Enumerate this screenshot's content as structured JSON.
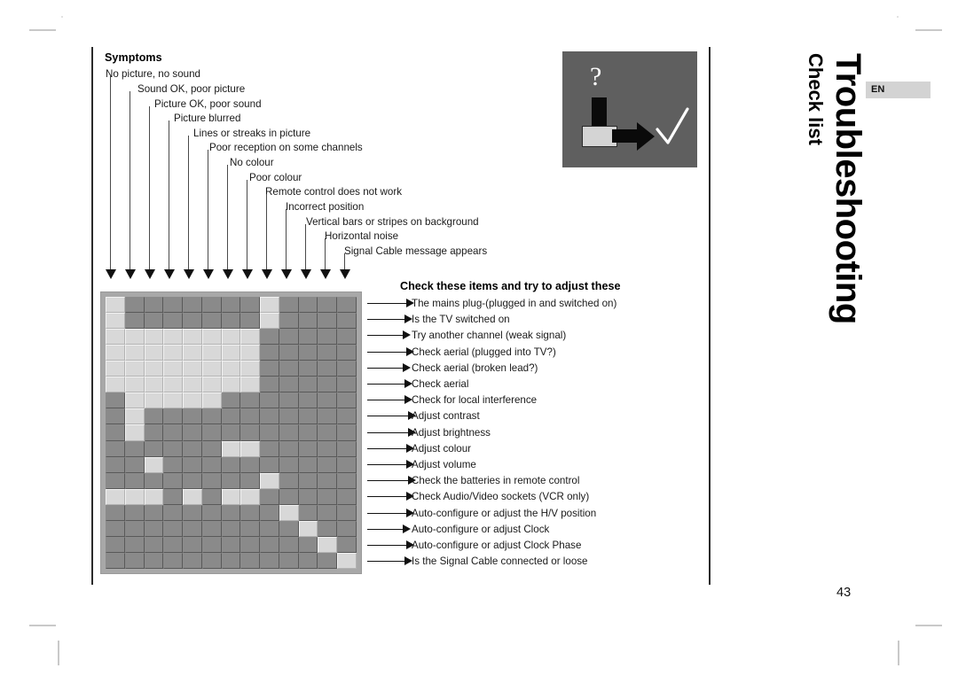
{
  "page": {
    "number": "43",
    "language_badge": "EN",
    "title_main": "Troubleshooting",
    "title_sub": "Check list"
  },
  "symptoms": {
    "heading": "Symptoms",
    "items": [
      "No picture, no sound",
      "Sound OK, poor picture",
      "Picture OK, poor sound",
      "Picture blurred",
      "Lines or streaks in picture",
      "Poor reception on some channels",
      "No colour",
      "Poor colour",
      "Remote control does not work",
      "Incorrect position",
      "Vertical bars or stripes on background",
      "Horizontal noise",
      "Signal Cable message appears"
    ]
  },
  "checklist": {
    "heading": "Check these items and try to adjust these",
    "items": [
      "The mains plug-(plugged in and switched on)",
      "Is the TV switched on",
      "Try another channel (weak signal)",
      "Check aerial (plugged into TV?)",
      "Check aerial (broken lead?)",
      "Check aerial",
      "Check for local interference",
      "Adjust contrast",
      "Adjust brightness",
      "Adjust colour",
      "Adjust volume",
      "Check the batteries in remote control",
      "Check Audio/Video sockets (VCR only)",
      "Auto-configure or adjust the H/V position",
      "Auto-configure or adjust Clock",
      "Auto-configure or adjust Clock Phase",
      "Is the Signal Cable connected or loose"
    ]
  },
  "matrix": {
    "columns": 13,
    "rows": 17,
    "colors": {
      "dark": "#8a8a8a",
      "light": "#d8d8d8",
      "frame": "#a8a8a8"
    },
    "marked_cells": [
      [
        0,
        8
      ],
      [
        0,
        8
      ],
      [
        0,
        1,
        2,
        3,
        4,
        5,
        6,
        7
      ],
      [
        0,
        1,
        2,
        3,
        4,
        5,
        6,
        7
      ],
      [
        0,
        1,
        2,
        3,
        4,
        5,
        6,
        7
      ],
      [
        0,
        1,
        2,
        3,
        4,
        5,
        6,
        7
      ],
      [
        1,
        2,
        3,
        4,
        5
      ],
      [
        1
      ],
      [
        1
      ],
      [
        6,
        7
      ],
      [
        2
      ],
      [
        8
      ],
      [
        0,
        1,
        2,
        4,
        6,
        7
      ],
      [
        9
      ],
      [
        10
      ],
      [
        11
      ],
      [
        12
      ]
    ]
  },
  "hero_icon": {
    "question_mark": "?",
    "background": "#5f5f5f",
    "check_color": "#ffffff"
  }
}
